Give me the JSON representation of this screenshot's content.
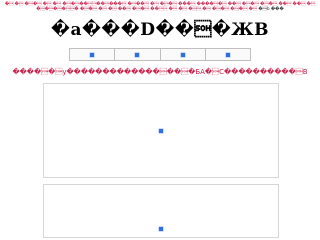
{
  "header": {
    "marquee_top": "�\u0001 �\u0001 �\u0001�\u0001 �\u0001 �\u0001 �\u0001�\u0001��\u0001\u0001��\u0001���\u0001 �\u0001��\u0001 �\u0001 �\u0001�\u0001 ���\u0001 ����\u0001�\u0001 ��\u0001 �\u0001�\u0001 �\u0001�\u0001 ��\u0001 ��\u0001 �\u0001 �\u0001�\u0001�\u0001�\u0001\u0001� �\u0001�\u0001 �\u0001 �\u0001 ��\u0001 �\u0001�\u0001 ��\u0001\u0001 �\u0001 �\u0001 �\u0001\u0001 �\u0001 �\u0001�\u0001 �\u0001�\u0001 �\u0001",
    "marquee_top_2": "�\u0001b ���",
    "site_title": "�a���D��\u0001�ЖB"
  },
  "nav": {
    "items": [
      {
        "icon": "broken-image-icon"
      },
      {
        "icon": "broken-image-icon"
      },
      {
        "icon": "broken-image-icon"
      },
      {
        "icon": "broken-image-icon"
      }
    ]
  },
  "announcement": {
    "text": "����\u0001�\u0001y�������������\u0001��\u0001�БA�\u0001C����������\u0001B"
  },
  "content": {
    "panel_1_icon": "broken-image-icon",
    "panel_2_icon": "broken-image-icon"
  },
  "colors": {
    "marquee": "#c8224c",
    "icon": "#2f6fe0",
    "border": "#d6d6d6"
  }
}
